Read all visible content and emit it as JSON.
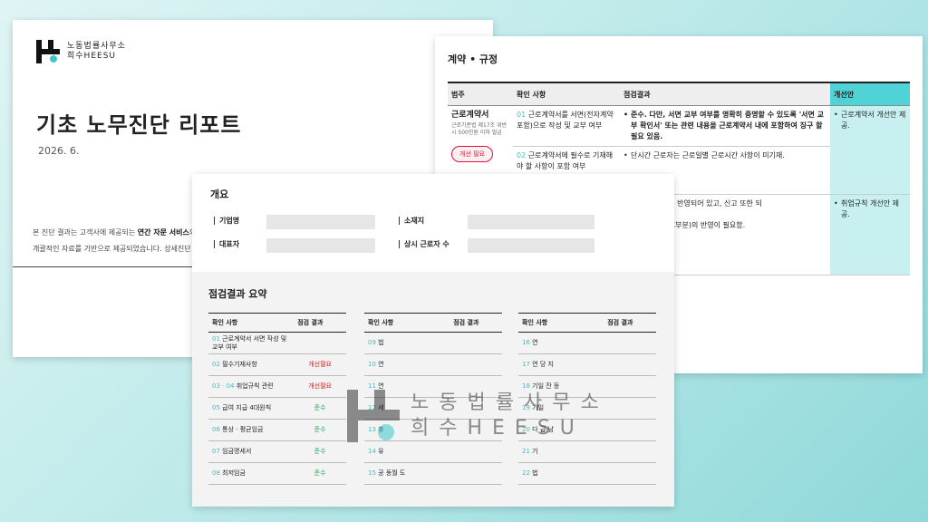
{
  "brand": {
    "name_kr": "노동법률사무소",
    "name_en": "희수HEESU",
    "accent": "#3fc7c9"
  },
  "cover": {
    "title": "기초 노무진단 리포트",
    "date": "2026. 6.",
    "desc_line1_pre": "본 진단 결과는 고객사에 제공되는",
    "desc_line1_bold": "연간 자문 서비스",
    "desc_line1_post": "의 일",
    "desc_line2": "개괄적인 자료를 기반으로 제공되었습니다. 상세진단 또"
  },
  "contract": {
    "section_title": "계약 • 규정",
    "headers": [
      "범주",
      "확인 사항",
      "점검결과",
      "개선안"
    ],
    "rows": [
      {
        "category": "근로계약서",
        "category_note": "근로기준법 제17조 위반시 500만원 이하 벌금",
        "badge": "개선 필요",
        "items": [
          {
            "num": "01",
            "text": "근로계약서를 서면(전자계약 포함)으로 작성 및 교부 여부",
            "result": "준수. 다만, 서면 교부 여부를 명확히 증명할 수 있도록 '서면 교부 확인서' 또는 관련 내용을 근로계약서 내에 포함하여 징구 할 필요 있음."
          },
          {
            "num": "02",
            "text": "근로계약서에 필수로 기재해야 할 사항이 포함 여부",
            "result": "단시간 근로자는 근로일별 근로시간 사항이 미기재."
          }
        ],
        "improvement": "근로계약서 개선안 제공."
      },
      {
        "result_a": "기재 사항이 모두 반영되어 있고, 신고 또한 되",
        "result_b": "점(특히 모성보호부분)의 반영이 필요함.",
        "improvement": "취업규칙 개선안 제공."
      }
    ]
  },
  "overview": {
    "title": "개요",
    "fields": [
      "기업명",
      "소재지",
      "대표자",
      "상시 근로자 수"
    ],
    "summary_title": "점검결과 요약",
    "col_headers": [
      "확인 사항",
      "점검 결과"
    ],
    "col1": [
      {
        "num": "01",
        "text": "근로계약서 서면 작성 및 교부 여부",
        "result": ""
      },
      {
        "num": "02",
        "text": "필수기재사항",
        "result": "개선필요",
        "status": "bad"
      },
      {
        "num": "03 · 04",
        "text": "취업규칙 관련",
        "result": "개선필요",
        "status": "bad"
      },
      {
        "num": "05",
        "text": "급여 지급 4대원칙",
        "result": "준수",
        "status": "good"
      },
      {
        "num": "06",
        "text": "통상 · 평균임금",
        "result": "준수",
        "status": "good"
      },
      {
        "num": "07",
        "text": "임금명세서",
        "result": "준수",
        "status": "good"
      },
      {
        "num": "08",
        "text": "최저임금",
        "result": "준수",
        "status": "good"
      }
    ],
    "col2": [
      {
        "num": "09",
        "text": "법"
      },
      {
        "num": "10",
        "text": "연"
      },
      {
        "num": "11",
        "text": "연"
      },
      {
        "num": "12",
        "text": "세"
      },
      {
        "num": "13",
        "text": "휴"
      },
      {
        "num": "14",
        "text": "유"
      },
      {
        "num": "15",
        "text": "공 동월 도"
      }
    ],
    "col3": [
      {
        "num": "16",
        "text": "연"
      },
      {
        "num": "17",
        "text": "연 당 지"
      },
      {
        "num": "18",
        "text": "기일 잔 등"
      },
      {
        "num": "19",
        "text": "기일"
      },
      {
        "num": "20",
        "text": "다 급 남"
      },
      {
        "num": "21",
        "text": "기"
      },
      {
        "num": "22",
        "text": "법"
      }
    ]
  }
}
